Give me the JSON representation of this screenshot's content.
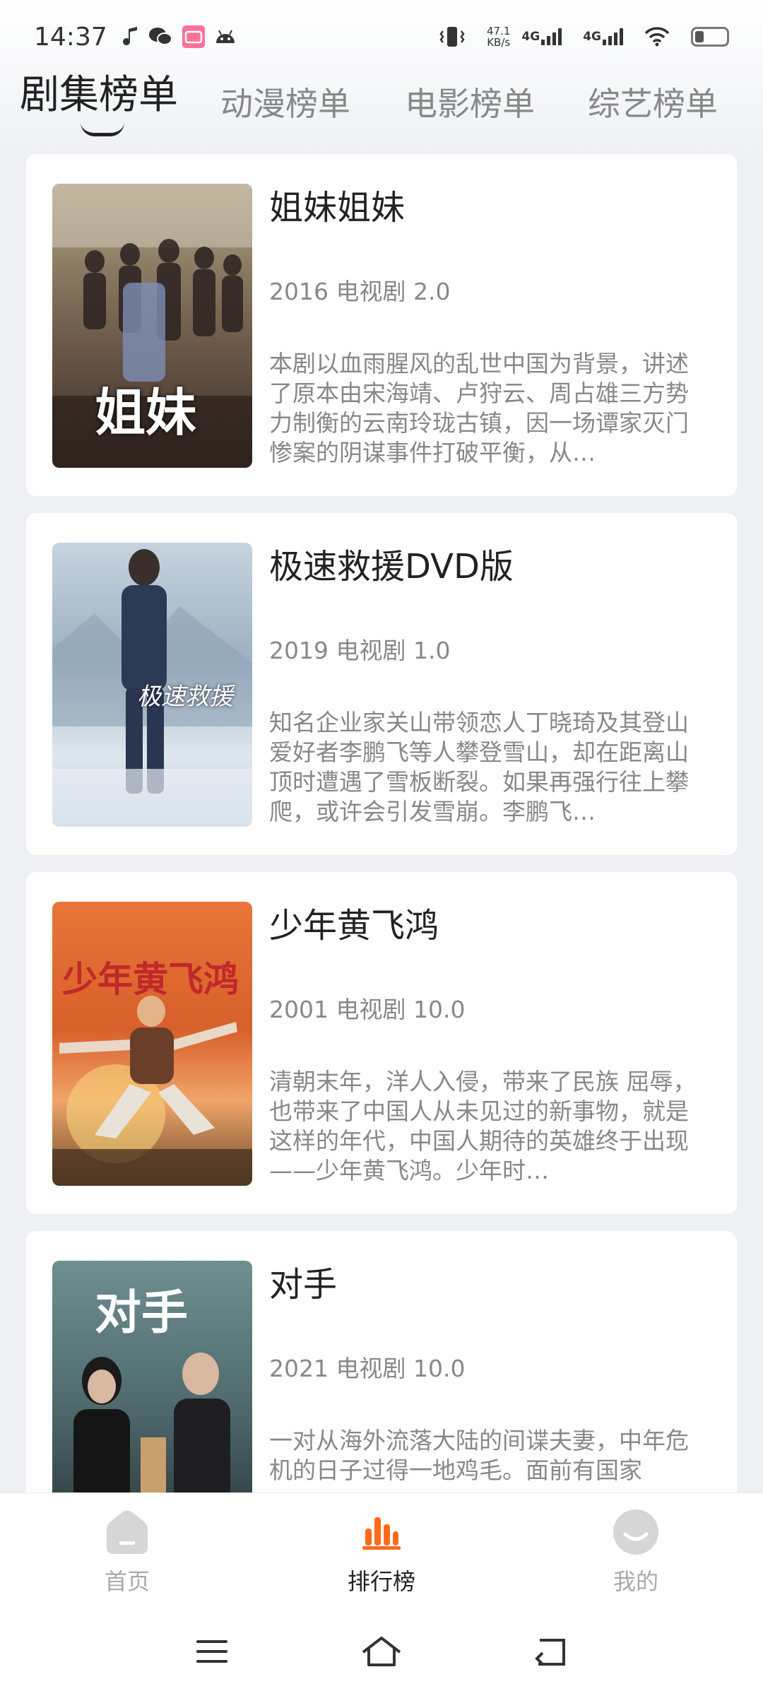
{
  "status": {
    "time": "14:37",
    "net_speed_value": "47.1",
    "net_speed_unit": "KB/s",
    "sim1": "4G",
    "sim2": "4G"
  },
  "tabs": [
    {
      "label": "剧集榜单",
      "active": true
    },
    {
      "label": "动漫榜单",
      "active": false
    },
    {
      "label": "电影榜单",
      "active": false
    },
    {
      "label": "综艺榜单",
      "active": false
    }
  ],
  "items": [
    {
      "title": "姐妹姐妹",
      "meta": "2016 电视剧 2.0",
      "description": "本剧以血雨腥风的乱世中国为背景，讲述了原本由宋海靖、卢狩云、周占雄三方势力制衡的云南玲珑古镇，因一场谭家灭门惨案的阴谋事件打破平衡，从…",
      "poster_text": "姐妹"
    },
    {
      "title": "极速救援DVD版",
      "meta": "2019 电视剧 1.0",
      "description": "知名企业家关山带领恋人丁晓琦及其登山爱好者李鹏飞等人攀登雪山，却在距离山顶时遭遇了雪板断裂。如果再强行往上攀爬，或许会引发雪崩。李鹏飞…",
      "poster_text": "极速救援"
    },
    {
      "title": "少年黄飞鸿",
      "meta": "2001 电视剧 10.0",
      "description": "清朝末年，洋人入侵，带来了民族 屈辱，也带来了中国人从未见过的新事物，就是这样的年代，中国人期待的英雄终于出现——少年黄飞鸿。少年时…",
      "poster_text": "少年黄飞鸿"
    },
    {
      "title": "对手",
      "meta": "2021 电视剧 10.0",
      "description": "一对从海外流落大陆的间谍夫妻，中年危机的日子过得一地鸡毛。面前有国家",
      "poster_text": "对手"
    }
  ],
  "bottom_nav": [
    {
      "label": "首页",
      "icon": "home-icon",
      "active": false
    },
    {
      "label": "排行榜",
      "icon": "rank-chart-icon",
      "active": true
    },
    {
      "label": "我的",
      "icon": "profile-icon",
      "active": false
    }
  ],
  "colors": {
    "accent": "#ff6a1a",
    "inactive": "#aaaaaa",
    "background": "#eef0f4"
  }
}
